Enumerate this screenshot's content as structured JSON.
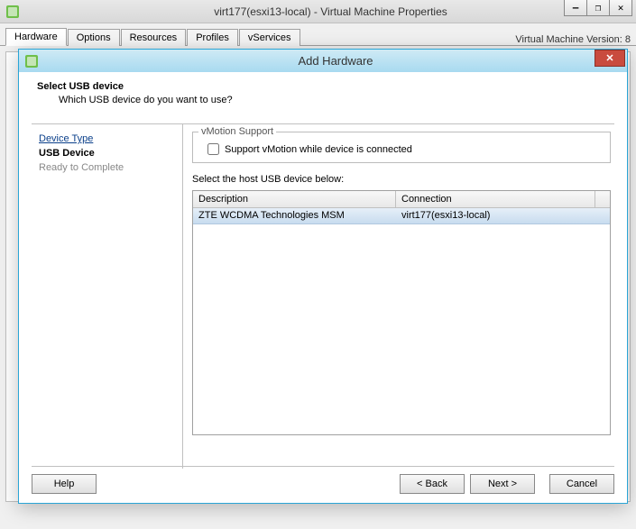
{
  "parent": {
    "title": "virt177(esxi13-local) - Virtual Machine Properties",
    "tabs": [
      "Hardware",
      "Options",
      "Resources",
      "Profiles",
      "vServices"
    ],
    "active_tab": 0,
    "version_label": "Virtual Machine Version: 8",
    "win": {
      "min": "—",
      "max": "❐",
      "close": "✕"
    }
  },
  "modal": {
    "title": "Add Hardware",
    "close": "✕",
    "step_title": "Select USB device",
    "step_subtitle": "Which USB device do you want to use?",
    "nav": {
      "device_type": "Device Type",
      "usb_device": "USB Device",
      "ready": "Ready to Complete"
    },
    "vmotion": {
      "group_title": "vMotion Support",
      "checkbox_label": "Support vMotion while device is connected",
      "checked": false
    },
    "select_label": "Select the host USB device below:",
    "table": {
      "headers": {
        "description": "Description",
        "connection": "Connection"
      },
      "rows": [
        {
          "description": "ZTE WCDMA Technologies MSM",
          "connection": "virt177(esxi13-local)"
        }
      ]
    },
    "buttons": {
      "help": "Help",
      "back": "< Back",
      "next": "Next >",
      "cancel": "Cancel"
    }
  }
}
